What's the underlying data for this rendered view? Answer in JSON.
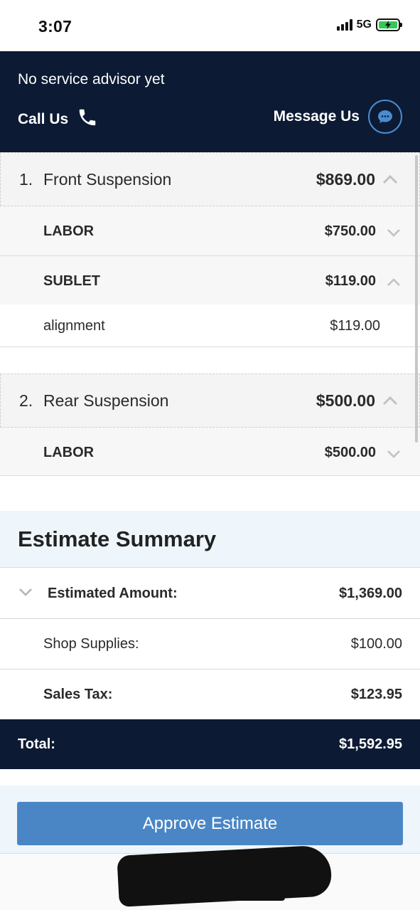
{
  "status_bar": {
    "time": "3:07",
    "network": "5G"
  },
  "header": {
    "advisor_text": "No service advisor yet",
    "call_label": "Call Us",
    "message_label": "Message Us"
  },
  "jobs": [
    {
      "number": "1.",
      "name": "Front Suspension",
      "price": "$869.00",
      "lines": [
        {
          "label": "LABOR",
          "price": "$750.00"
        },
        {
          "label": "SUBLET",
          "price": "$119.00",
          "items": [
            {
              "label": "alignment",
              "price": "$119.00"
            }
          ]
        }
      ]
    },
    {
      "number": "2.",
      "name": "Rear Suspension",
      "price": "$500.00",
      "lines": [
        {
          "label": "LABOR",
          "price": "$500.00"
        }
      ]
    }
  ],
  "summary": {
    "title": "Estimate Summary",
    "estimated_label": "Estimated Amount:",
    "estimated_value": "$1,369.00",
    "shop_supplies_label": "Shop Supplies:",
    "shop_supplies_value": "$100.00",
    "sales_tax_label": "Sales Tax:",
    "sales_tax_value": "$123.95",
    "total_label": "Total:",
    "total_value": "$1,592.95"
  },
  "approve_label": "Approve Estimate",
  "colors": {
    "navy": "#0c1a33",
    "accent": "#4a86c5",
    "summary_bg": "#eef6fb",
    "battery": "#34c759"
  },
  "icons": [
    "phone-icon",
    "chat-bubble-icon",
    "chevron-up-icon",
    "chevron-down-icon"
  ]
}
